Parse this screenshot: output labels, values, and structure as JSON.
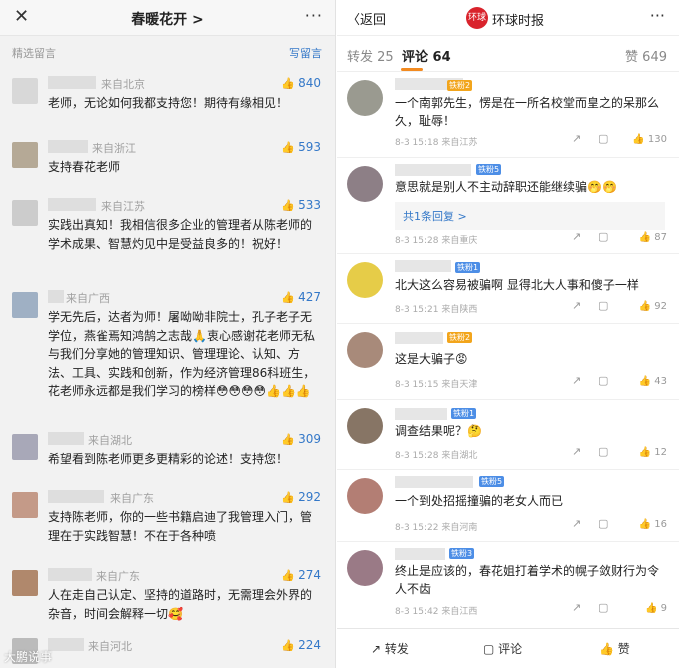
{
  "left": {
    "header": {
      "close_icon": "close-icon",
      "title": "春暖花开 >",
      "more": "···"
    },
    "selected_label": "精选留言",
    "write_label": "写留言",
    "comments": [
      {
        "location": "来自北京",
        "likes": "840",
        "text": "老师，无论如何我都支持您！期待有缘相见！"
      },
      {
        "location": "来自浙江",
        "likes": "593",
        "text": "支持春花老师"
      },
      {
        "location": "来自江苏",
        "likes": "533",
        "text": "实践出真知！我相信很多企业的管理者从陈老师的学术成果、智慧灼见中是受益良多的！祝好！"
      },
      {
        "location": "来自广西",
        "likes": "427",
        "text": "学无先后，达者为师！屠呦呦非院士，孔子老子无学位，燕雀焉知鸿鹄之志哉🙏衷心感谢花老师无私与我们分享她的管理知识、管理理论、认知、方法、工具、实践和创新，作为经济管理86科班生，花老师永远都是我们学习的榜样😳😳😳😳👍👍👍"
      },
      {
        "location": "来自湖北",
        "likes": "309",
        "text": "希望看到陈老师更多更精彩的论述！支持您！"
      },
      {
        "location": "来自广东",
        "likes": "292",
        "text": "支持陈老师，你的一些书籍启迪了我管理入门，管理在于实践智慧！不在于各种喷"
      },
      {
        "location": "来自广东",
        "likes": "274",
        "text": "人在走自己认定、坚持的道路时，无需理会外界的杂音，时间会解释一切🥰"
      },
      {
        "location": "来自河北",
        "likes": "224",
        "text": ""
      }
    ],
    "watermark": "大鹏说事"
  },
  "right": {
    "header": {
      "back_label": "返回",
      "logo_text": "环球",
      "account": "环球时报",
      "more": "···"
    },
    "tabs": {
      "repost": "转发 25",
      "comment": "评论 64",
      "like": "赞 649"
    },
    "comments": [
      {
        "badge": "铁粉2",
        "text": "一个南郭先生，愣是在一所名校堂而皇之的呆那么久，耻辱！",
        "meta": "8-3 15:18  来自江苏",
        "likes": "130"
      },
      {
        "badge": "铁粉5",
        "text": "意思就是别人不主动辞职还能继续骗🤭🤭",
        "reply": "共1条回复 >",
        "meta": "8-3 15:28  来自重庆",
        "likes": "87"
      },
      {
        "badge": "铁粉1",
        "text": "北大这么容易被骗啊 显得北大人事和傻子一样",
        "meta": "8-3 15:21  来自陕西",
        "likes": "92"
      },
      {
        "badge": "铁粉2",
        "text": "这是大骗子😡",
        "meta": "8-3 15:15  来自天津",
        "likes": "43"
      },
      {
        "badge": "铁粉1",
        "text": "调查结果呢？🤔",
        "meta": "8-3 15:28  来自湖北",
        "likes": "12"
      },
      {
        "badge": "铁粉5",
        "text": "一个到处招摇撞骗的老女人而已",
        "meta": "8-3 15:22  来自河南",
        "likes": "16"
      },
      {
        "badge": "铁粉3",
        "text": "终止是应该的，春花姐打着学术的幌子敛财行为令人不齿",
        "meta": "8-3 15:42  来自江西",
        "likes": "9"
      }
    ],
    "bottom": {
      "repost": "转发",
      "comment": "评论",
      "like": "赞"
    }
  }
}
